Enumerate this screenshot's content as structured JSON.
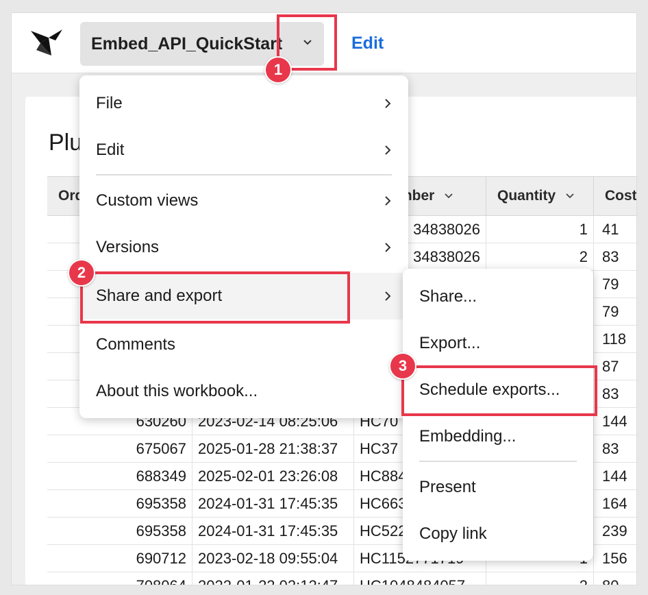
{
  "header": {
    "workbook_name": "Embed_API_QuickStart",
    "edit_label": "Edit"
  },
  "page": {
    "title": "Plu"
  },
  "table": {
    "columns": [
      "Ord",
      "mber",
      "Quantity",
      "Cost"
    ],
    "rows": [
      {
        "order": "",
        "date": "",
        "sku": "34838026",
        "qty": "1",
        "cost": "41"
      },
      {
        "order": "",
        "date": "",
        "sku": "34838026",
        "qty": "2",
        "cost": "83"
      },
      {
        "order": "",
        "date": "",
        "sku": "",
        "qty": "",
        "cost": "79"
      },
      {
        "order": "",
        "date": "",
        "sku": "",
        "qty": "",
        "cost": "79"
      },
      {
        "order": "",
        "date": "",
        "sku": "",
        "qty": "",
        "cost": "118"
      },
      {
        "order": "",
        "date": "",
        "sku": "",
        "qty": "",
        "cost": "87"
      },
      {
        "order": "",
        "date": "",
        "sku": "",
        "qty": "",
        "cost": "83"
      },
      {
        "order": "630260",
        "date": "2023-02-14 08:25:06",
        "sku": "HC70",
        "qty": "",
        "cost": "144"
      },
      {
        "order": "675067",
        "date": "2025-01-28 21:38:37",
        "sku": "HC37",
        "qty": "",
        "cost": "83"
      },
      {
        "order": "688349",
        "date": "2025-02-01 23:26:08",
        "sku": "HC884",
        "qty": "",
        "cost": "144"
      },
      {
        "order": "695358",
        "date": "2024-01-31 17:45:35",
        "sku": "HC663",
        "qty": "",
        "cost": "164"
      },
      {
        "order": "695358",
        "date": "2024-01-31 17:45:35",
        "sku": "HC522",
        "qty": "",
        "cost": "239"
      },
      {
        "order": "690712",
        "date": "2023-02-18 09:55:04",
        "sku": "HC1152771719",
        "qty": "1",
        "cost": "156"
      },
      {
        "order": "708064",
        "date": "2022-01-22 02:12:47",
        "sku": "HC1048484057",
        "qty": "2",
        "cost": "80"
      }
    ]
  },
  "main_menu": {
    "items": [
      {
        "label": "File",
        "has_submenu": true
      },
      {
        "label": "Edit",
        "has_submenu": true
      },
      {
        "label": "Custom views",
        "has_submenu": true
      },
      {
        "label": "Versions",
        "has_submenu": true
      },
      {
        "label": "Share and export",
        "has_submenu": true
      },
      {
        "label": "Comments",
        "has_submenu": false
      },
      {
        "label": "About this workbook...",
        "has_submenu": false
      }
    ]
  },
  "sub_menu": {
    "items": [
      {
        "label": "Share..."
      },
      {
        "label": "Export..."
      },
      {
        "label": "Schedule exports..."
      },
      {
        "label": "Embedding..."
      },
      {
        "label": "Present"
      },
      {
        "label": "Copy link"
      }
    ]
  },
  "annotations": {
    "badges": [
      "1",
      "2",
      "3"
    ],
    "color": "#e8374b"
  },
  "colors": {
    "accent": "#1a6ddb",
    "highlight": "#e8374b"
  }
}
